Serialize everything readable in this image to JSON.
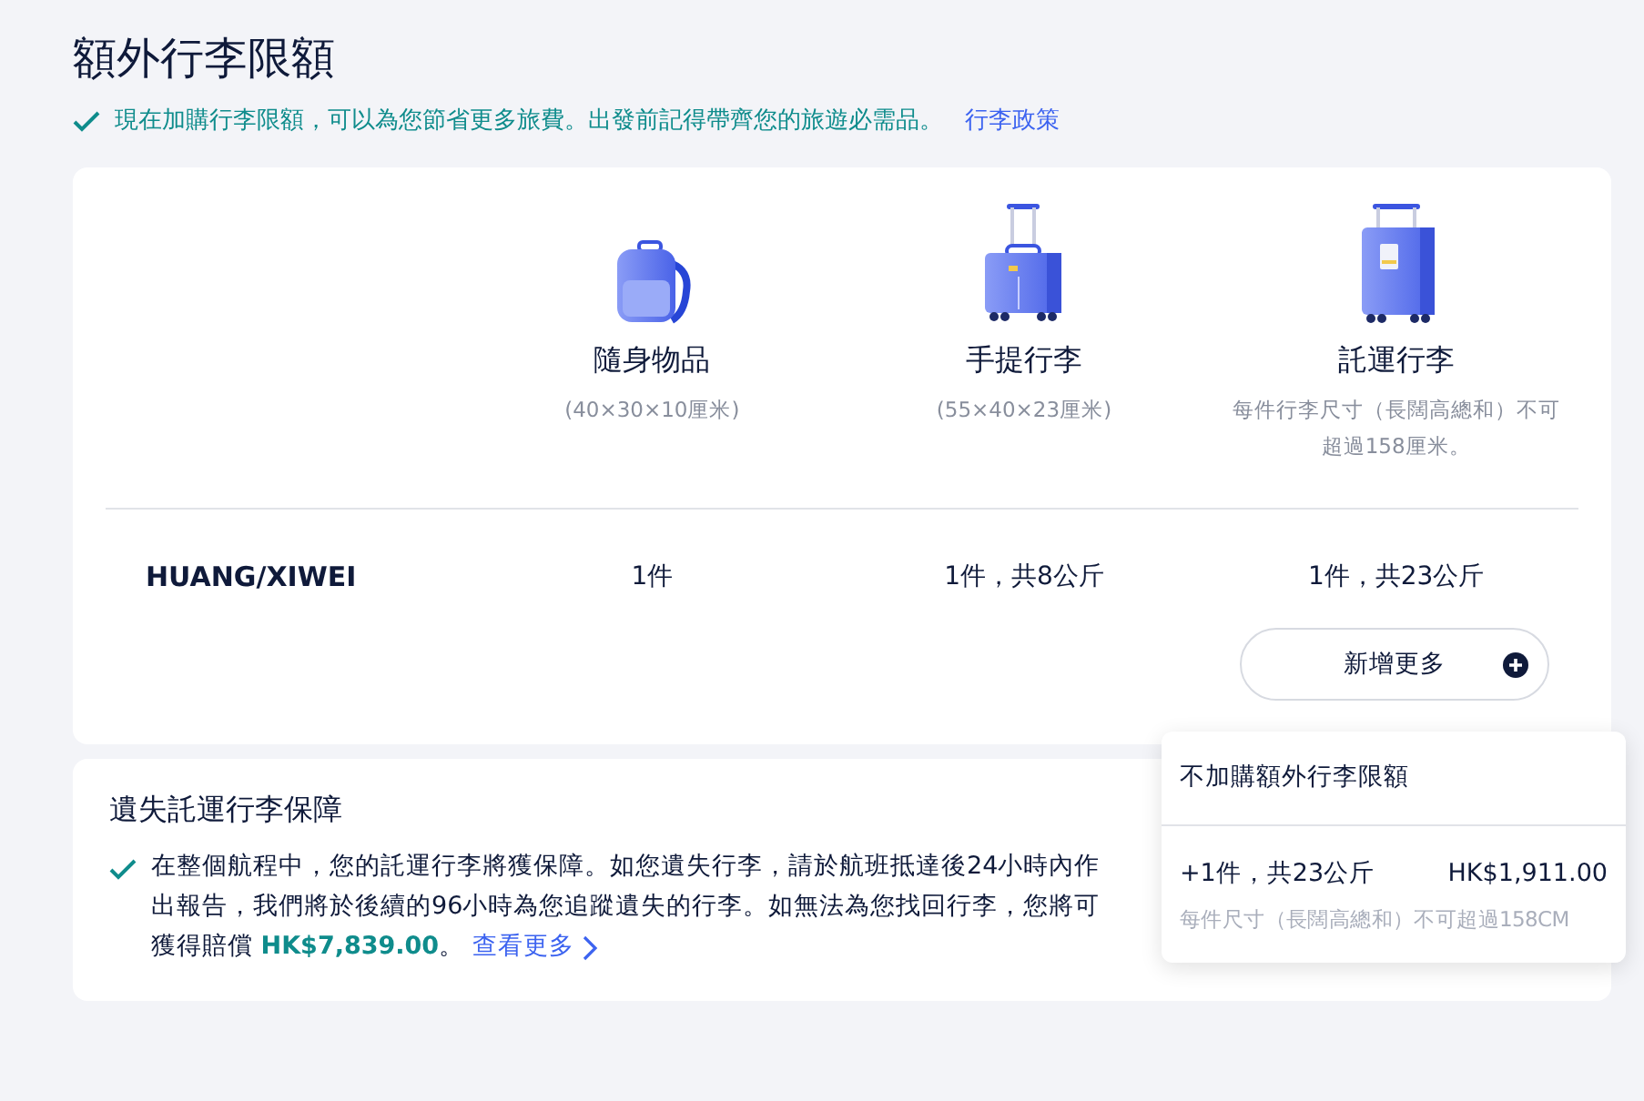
{
  "title": "額外行李限額",
  "notice": {
    "text": "現在加購行李限額，可以為您節省更多旅費。出發前記得帶齊您的旅遊必需品。",
    "link": "行李政策"
  },
  "baggage_types": [
    {
      "kind": "backpack",
      "name": "隨身物品",
      "size": "(40×30×10厘米)"
    },
    {
      "kind": "carry_on",
      "name": "手提行李",
      "size": "(55×40×23厘米)"
    },
    {
      "kind": "checked",
      "name": "託運行李",
      "size": "每件行李尺寸（長闊高總和）不可超過158厘米。"
    }
  ],
  "passengers": [
    {
      "name": "HUANG/XIWEI",
      "allowances": [
        "1件",
        "1件，共8公斤",
        "1件，共23公斤"
      ]
    }
  ],
  "add_button": "新增更多",
  "dropdown": {
    "options": [
      {
        "label": "不加購額外行李限額"
      },
      {
        "label": "+1件，共23公斤",
        "price": "HK$1,911.00",
        "note": "每件尺寸（長闊高總和）不可超過158CM"
      }
    ]
  },
  "protection": {
    "title": "遺失託運行李保障",
    "text": "在整個航程中，您的託運行李將獲保障。如您遺失行李，請於航班抵達後24小時內作出報告，我們將於後續的96小時為您追蹤遺失的行李。如無法為您找回行李，您將可獲得賠償 **HK$7,839.00**。",
    "link": "查看更多"
  }
}
